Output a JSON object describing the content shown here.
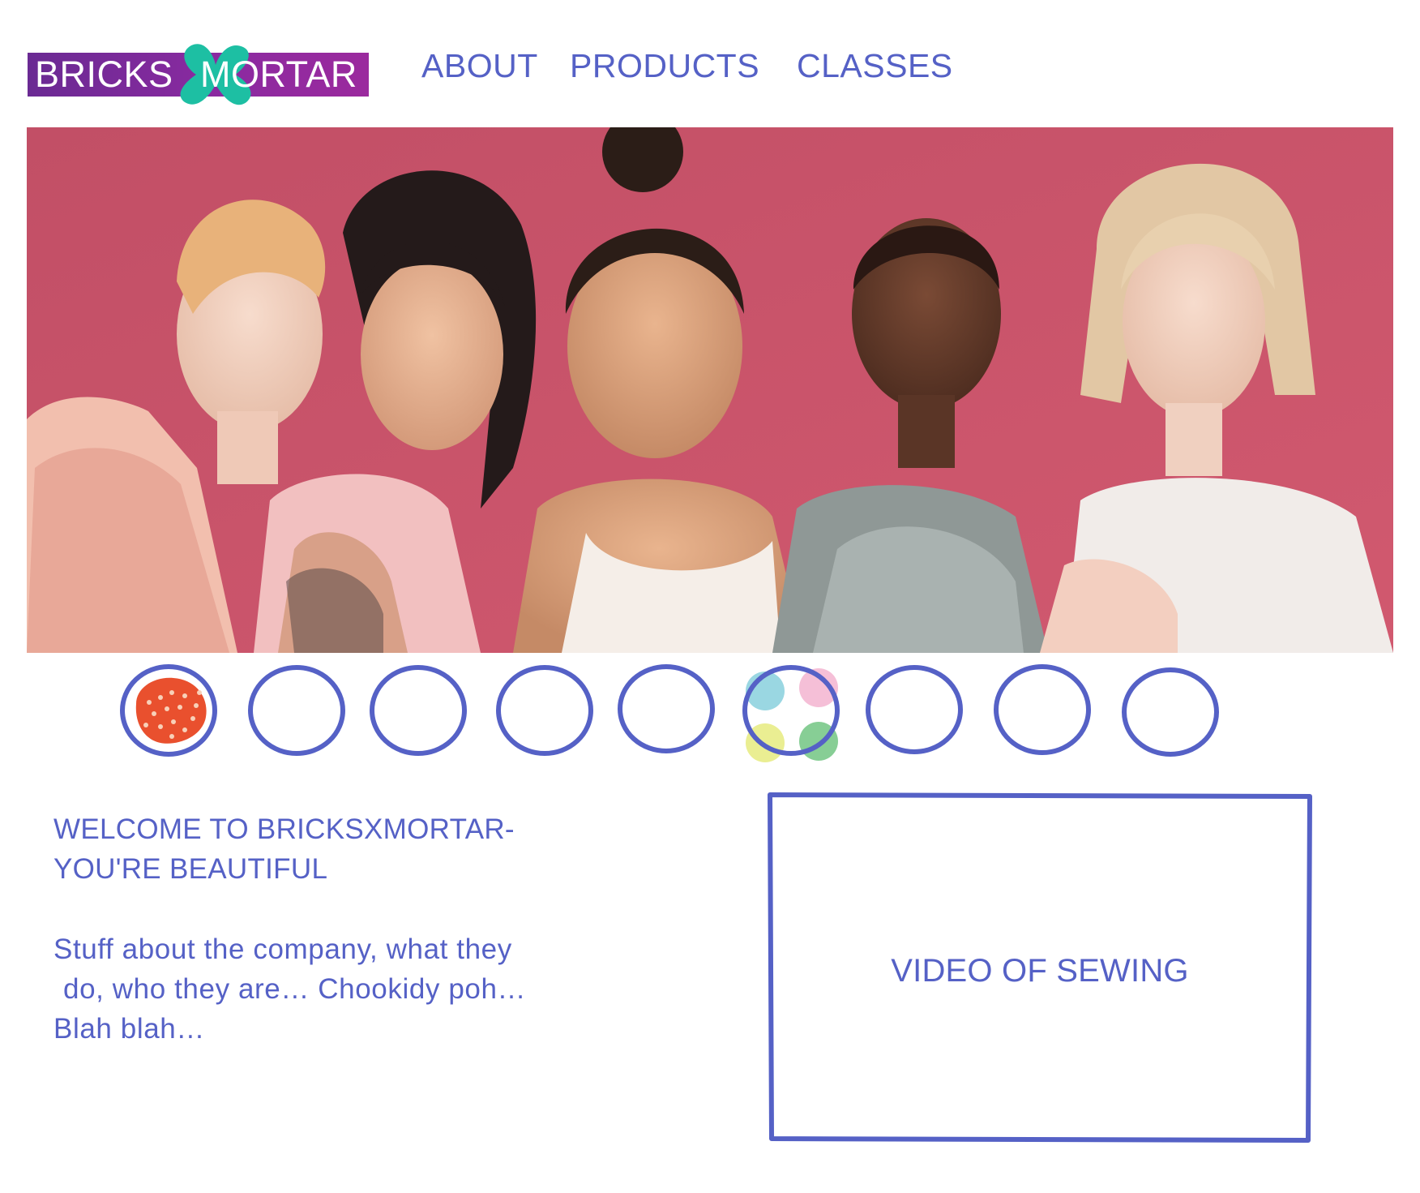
{
  "logo": {
    "left_text": "BRICKS",
    "right_text": "MORTAR",
    "background": "#7b2a9b",
    "x_color": "#1dbfa3"
  },
  "nav": {
    "about": "ABOUT",
    "products": "PRODUCTS",
    "classes": "CLASSES"
  },
  "hero": {
    "background": "#c9546a",
    "people_count": 5
  },
  "carousel": {
    "count": 9,
    "accent": "#5561c6",
    "thumbnails": [
      "strawberry-pattern",
      "empty",
      "empty",
      "empty",
      "empty",
      "pastel-dots",
      "empty",
      "empty",
      "empty"
    ]
  },
  "welcome": {
    "line1": "WELCOME TO BRICKSXMORTAR-",
    "line2": "YOU'RE BEAUTIFUL"
  },
  "about": {
    "line1": "Stuff about the company, what they",
    "line2": "do, who they are… Chookidy poh…",
    "line3": "Blah blah…"
  },
  "video": {
    "label": "VIDEO OF SEWING"
  },
  "colors": {
    "accent": "#5561c6",
    "text": "#5561c6"
  }
}
